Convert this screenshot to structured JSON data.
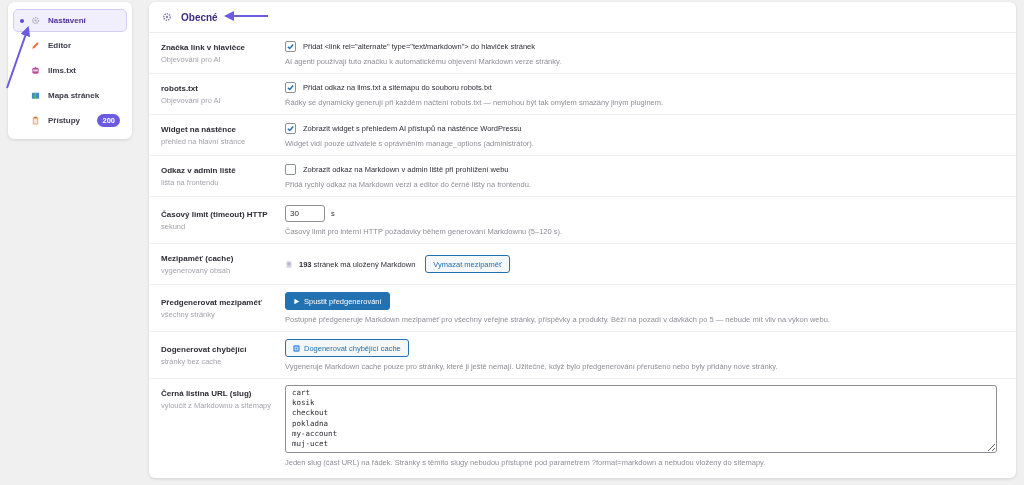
{
  "sidebar": {
    "items": [
      {
        "label": "Nastavení",
        "selected": true
      },
      {
        "label": "Editor",
        "selected": false
      },
      {
        "label": "llms.txt",
        "selected": false
      },
      {
        "label": "Mapa stránek",
        "selected": false
      },
      {
        "label": "Přístupy",
        "selected": false,
        "badge": "200"
      }
    ]
  },
  "section": {
    "title": "Obecné"
  },
  "rows": [
    {
      "kind": "checkbox",
      "label": "Značka link v hlavičce",
      "sublabel": "Objevování pro AI",
      "text": "Přidat <link rel=\"alternate\" type=\"text/markdown\"> do hlaviček stránek",
      "checked": true,
      "description": "AI agenti používají tuto značku k automatickému objevení Markdown verze stránky."
    },
    {
      "kind": "checkbox",
      "label": "robots.txt",
      "sublabel": "Objevování pro AI",
      "text": "Přidat odkaz na llms.txt a sitemapu do souboru robots.txt",
      "checked": true,
      "description": "Řádky se dynamicky generují při každém načtení robots.txt — nemohou být tak omylem smazány jiným pluginem."
    },
    {
      "kind": "checkbox",
      "label": "Widget na nástěnce",
      "sublabel": "přehled na hlavní stránce",
      "text": "Zobrazit widget s přehledem AI přístupů na nástěnce WordPressu",
      "checked": true,
      "description": "Widget vidí pouze uživatelé s oprávněním manage_options (administrátor)."
    },
    {
      "kind": "checkbox",
      "label": "Odkaz v admin liště",
      "sublabel": "lišta na frontendu",
      "text": "Zobrazit odkaz na Markdown v admin liště při prohlížení webu",
      "checked": false,
      "description": "Přidá rychlý odkaz na Markdown verzi a editor do černé lišty na frontendu."
    },
    {
      "kind": "number",
      "label": "Časový limit (timeout) HTTP",
      "sublabel": "sekund",
      "value": "30",
      "unit": "s",
      "description": "Časový limit pro interní HTTP požadavky během generování Markdownu (5–120 s)."
    },
    {
      "kind": "cache",
      "label": "Mezipaměť (cache)",
      "sublabel": "vygenerovaný obsah",
      "count": "193",
      "text": "stránek má uložený Markdown",
      "button": "Vymazat mezipaměť"
    },
    {
      "kind": "primary_button",
      "label": "Předgenerovat mezipaměť",
      "sublabel": "všechny stránky",
      "button": "Spustit předgenerování",
      "description": "Postupně předgeneruje Markdown mezipaměť pro všechny veřejné stránky, příspěvky a produkty. Běží na pozadí v dávkách po 5 — nebude mít vliv na výkon webu."
    },
    {
      "kind": "secondary_button",
      "label": "Dogenerovat chybějící",
      "sublabel": "stránky bez cache",
      "button": "Dogenerovat chybějící cache",
      "description": "Vygeneruje Markdown cache pouze pro stránky, které ji ještě nemají. Užitečné, když bylo předgenerování přerušeno nebo byly přidány nové stránky."
    },
    {
      "kind": "textarea",
      "label": "Černá listina URL (slug)",
      "sublabel": "vyloučit z Markdownu a sitemapy",
      "lines": [
        "cart",
        "kosik",
        "checkout",
        "pokladna",
        "my-account",
        "muj-ucet"
      ],
      "description": "Jeden slug (část URL) na řádek. Stránky s těmito slugy nebudou přístupné pod parametrem ?format=markdown a nebudou vloženy do sitemapy."
    }
  ]
}
